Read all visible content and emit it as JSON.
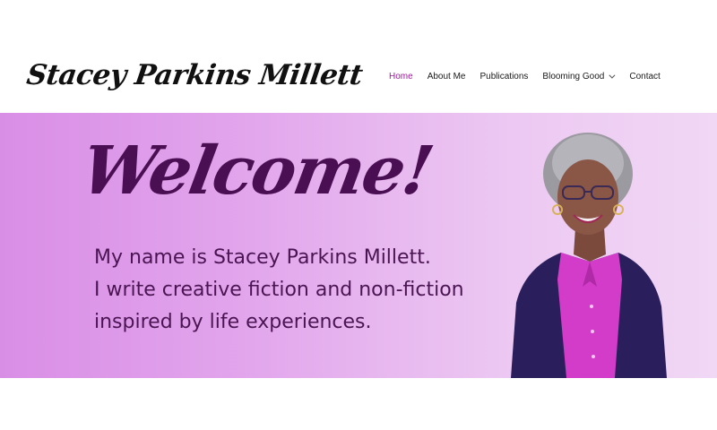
{
  "site": {
    "title": "Stacey Parkins Millett"
  },
  "nav": {
    "items": [
      {
        "label": "Home",
        "active": true
      },
      {
        "label": "About Me"
      },
      {
        "label": "Publications"
      },
      {
        "label": "Blooming Good",
        "has_dropdown": true
      },
      {
        "label": "Contact"
      }
    ]
  },
  "hero": {
    "heading": "Welcome!",
    "lines": [
      "My name is Stacey Parkins Millett.",
      "I write creative fiction and non-fiction",
      "inspired by life experiences."
    ]
  },
  "colors": {
    "accent": "#a01a9e",
    "heading": "#4a0f52",
    "hero_gradient_start": "#d98ee6",
    "hero_gradient_end": "#f1d8f5"
  },
  "icons": {
    "dropdown": "chevron-down-icon"
  }
}
